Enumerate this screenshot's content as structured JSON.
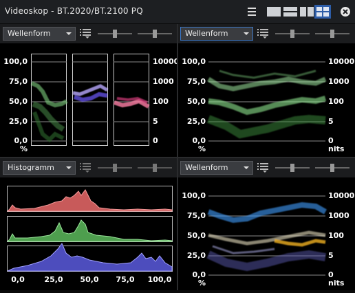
{
  "window": {
    "title": "Videoskop - BT.2020/BT.2100 PQ"
  },
  "panels": {
    "top_left": {
      "mode": "Wellenform"
    },
    "top_right": {
      "mode": "Wellenform"
    },
    "bottom_left": {
      "mode": "Histogramm"
    },
    "bottom_right": {
      "mode": "Wellenform"
    }
  },
  "scale": {
    "left_ticks": [
      "100,0",
      "75,0",
      "50,0",
      "25,0",
      "0,0"
    ],
    "left_unit": "%",
    "right_ticks": [
      "10000",
      "1000",
      "100",
      "5",
      "0"
    ],
    "right_unit": "nits"
  },
  "histogram": {
    "x_ticks": [
      "0,0",
      "25,0",
      "50,0",
      "75,0",
      "100,0"
    ]
  },
  "colors": {
    "accent": "#3b78c8",
    "red": "#e06a6a",
    "green": "#6ccf6c",
    "blue": "#6f6fe0"
  },
  "icons": {
    "menu": "hamburger-icon",
    "layout1": "single-layout-icon",
    "layout2": "two-row-layout-icon",
    "layout4": "quad-layout-icon",
    "close": "close-icon",
    "list": "list-menu-icon",
    "slider": "slider-icon"
  }
}
